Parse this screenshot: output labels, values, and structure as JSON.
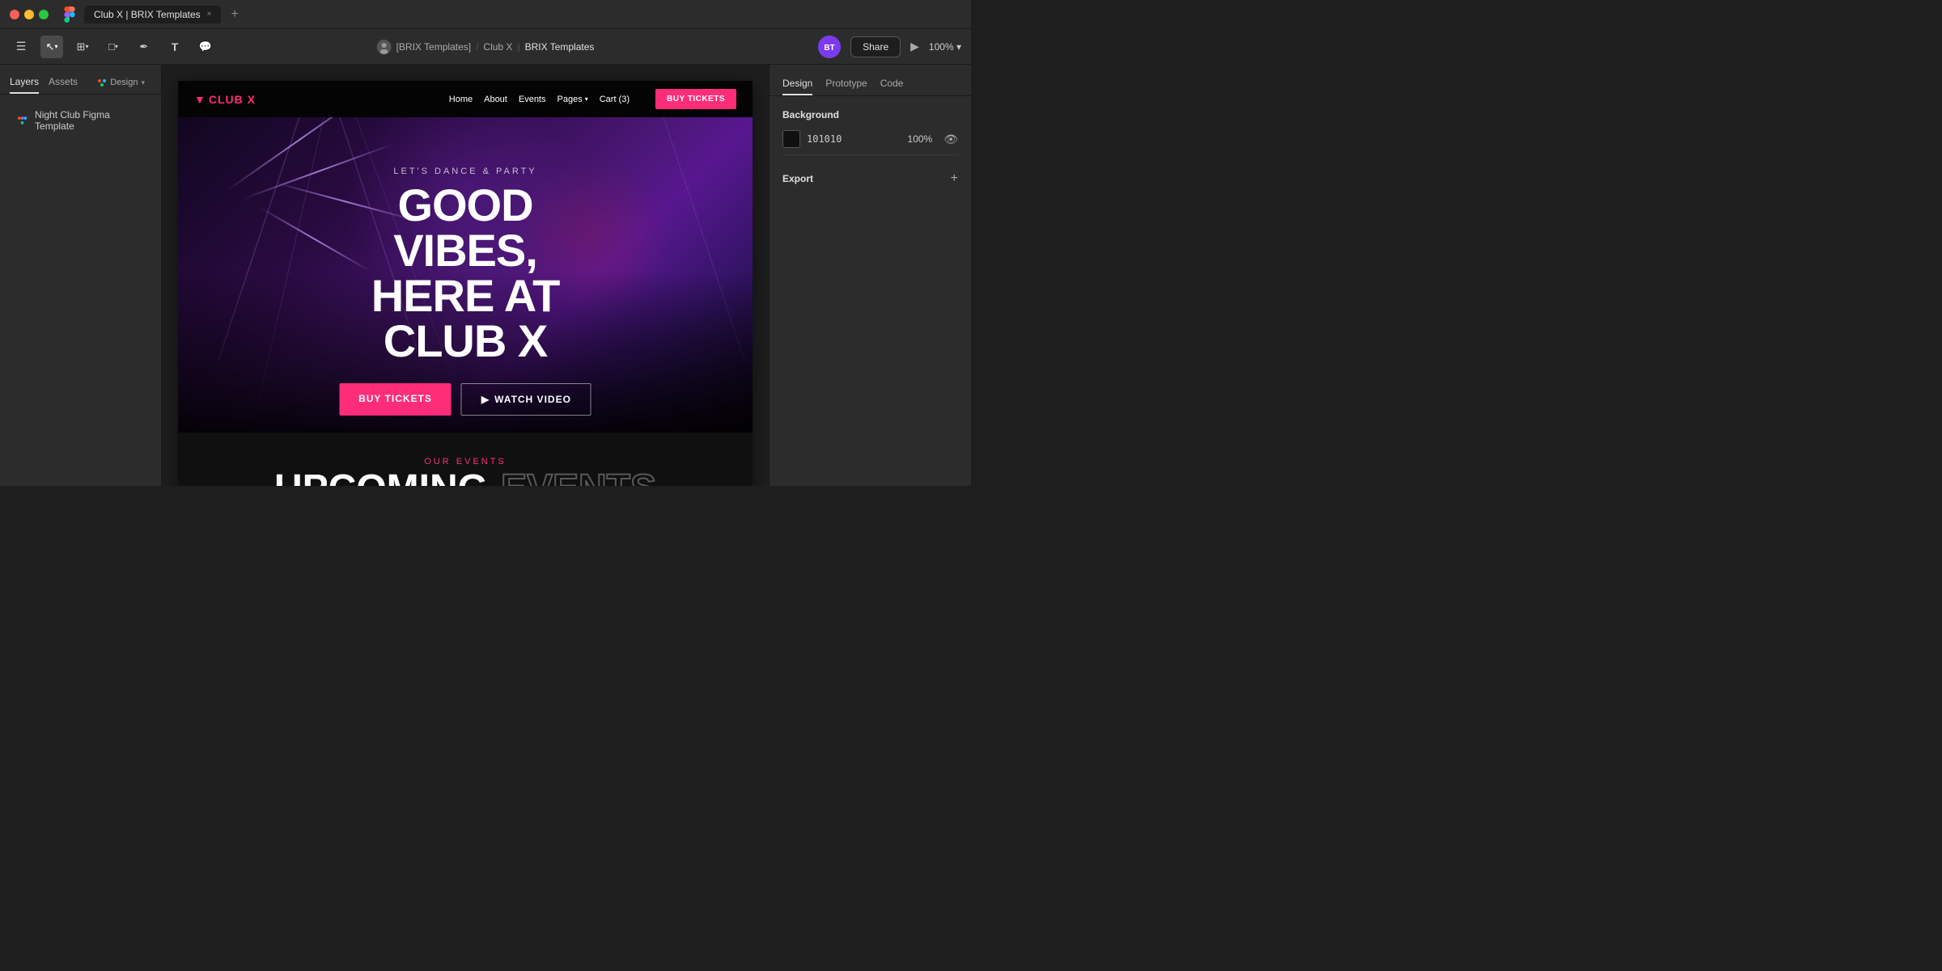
{
  "window": {
    "tab_title": "Club X | BRIX Templates",
    "tab_close": "×",
    "tab_add": "+"
  },
  "toolbar": {
    "menu_icon": "☰",
    "arrow_icon": "↖",
    "frame_icon": "⊞",
    "shape_icon": "□",
    "pen_icon": "✒",
    "text_icon": "T",
    "comment_icon": "💬",
    "breadcrumb": {
      "avatar_label": "BT",
      "team": "[BRIX Templates]",
      "separator": "/",
      "project": "Club X",
      "separator2": "|",
      "file": "BRIX Templates"
    },
    "share_label": "Share",
    "play_icon": "▶",
    "zoom": "100%",
    "zoom_chevron": "▾"
  },
  "left_sidebar": {
    "tabs": [
      {
        "label": "Layers",
        "active": true
      },
      {
        "label": "Assets",
        "active": false
      }
    ],
    "design_pill": "🎨 Design ▾",
    "layer_items": [
      {
        "label": "Night Club Figma Template",
        "icon_type": "figma-component"
      }
    ]
  },
  "right_sidebar": {
    "tabs": [
      {
        "label": "Design",
        "active": true
      },
      {
        "label": "Prototype",
        "active": false
      },
      {
        "label": "Code",
        "active": false
      }
    ],
    "background_section": {
      "title": "Background",
      "color_hex": "101010",
      "opacity": "100%",
      "has_eye": true
    },
    "export_section": {
      "title": "Export",
      "add_icon": "+"
    }
  },
  "canvas": {
    "website": {
      "nav": {
        "logo": "CLUB X",
        "logo_icon": "▼",
        "links": [
          "Home",
          "About",
          "Events",
          "Pages",
          "Cart (3)"
        ],
        "pages_chevron": "▾",
        "buy_btn": "BUY TICKETS"
      },
      "hero": {
        "subtitle": "LET'S DANCE & PARTY",
        "title_line1": "GOOD VIBES,",
        "title_line2": "HERE AT CLUB X",
        "btn_primary": "BUY TICKETS",
        "btn_secondary_icon": "▶",
        "btn_secondary": "WATCH VIDEO"
      },
      "events": {
        "label": "OUR EVENTS",
        "title_solid": "UPCOMING",
        "title_outline": "EVENTS"
      }
    }
  }
}
